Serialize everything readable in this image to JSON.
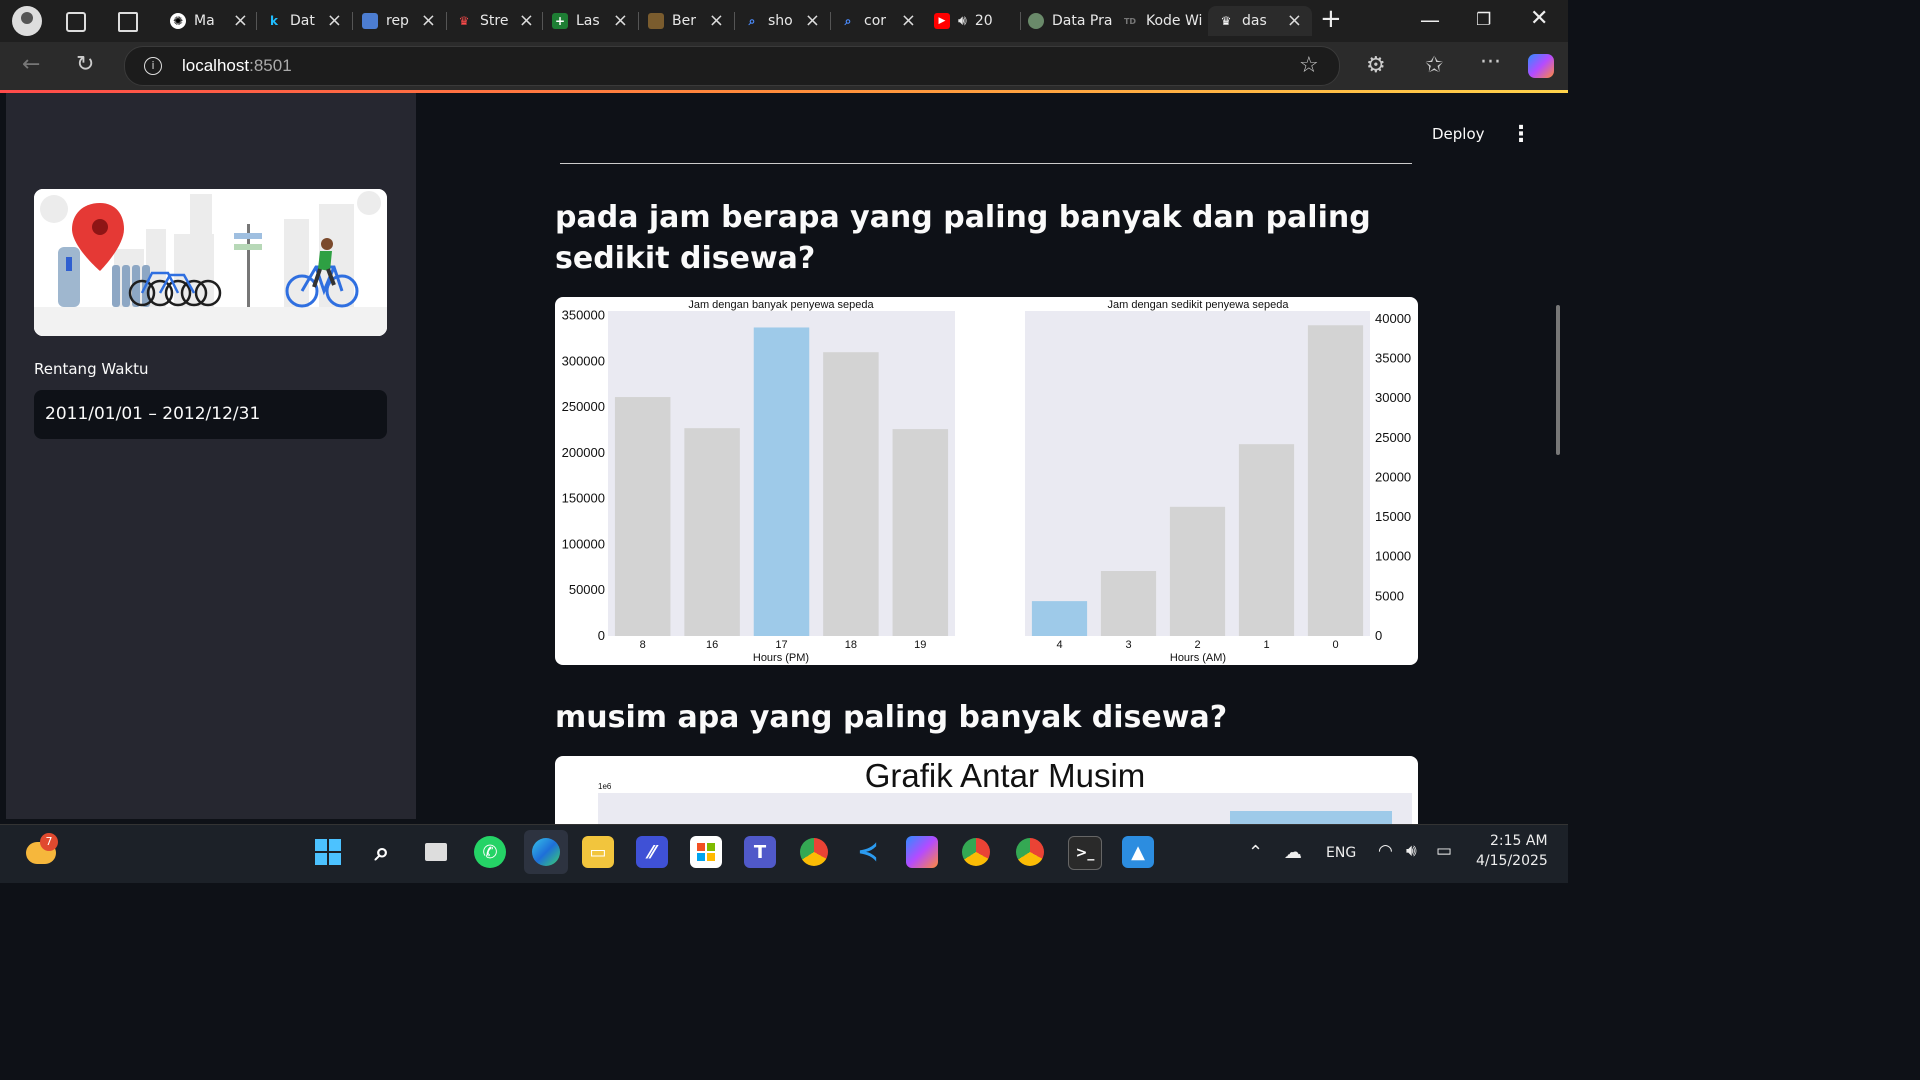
{
  "browser": {
    "tabs": [
      {
        "label": "Ma"
      },
      {
        "label": "Dat"
      },
      {
        "label": "rep"
      },
      {
        "label": "Stre"
      },
      {
        "label": "Las"
      },
      {
        "label": "Ber"
      },
      {
        "label": "sho"
      },
      {
        "label": "cor"
      },
      {
        "label": "20"
      },
      {
        "label": "Data Pra"
      },
      {
        "label": "Kode Wi"
      },
      {
        "label": "das"
      }
    ],
    "url_host": "localhost",
    "url_port": ":8501"
  },
  "sidebar": {
    "date_label": "Rentang Waktu",
    "date_value": "2011/01/01 – 2012/12/31"
  },
  "header": {
    "deploy_label": "Deploy"
  },
  "main": {
    "question1": "pada jam berapa yang paling banyak dan paling sedikit disewa?",
    "question2": "musim apa yang paling banyak disewa?"
  },
  "chart_data": [
    {
      "type": "bar",
      "title": "Jam dengan banyak penyewa sepeda",
      "xlabel": "Hours (PM)",
      "ylabel": "",
      "categories": [
        "8",
        "16",
        "17",
        "18",
        "19"
      ],
      "values": [
        261000,
        227000,
        337000,
        310000,
        226000
      ],
      "highlight_index": 2,
      "ylim": [
        0,
        355000
      ],
      "yticks": [
        0,
        50000,
        100000,
        150000,
        200000,
        250000,
        300000,
        350000
      ],
      "yaxis_side": "left"
    },
    {
      "type": "bar",
      "title": "Jam dengan sedikit penyewa sepeda",
      "xlabel": "Hours (AM)",
      "ylabel": "",
      "categories": [
        "4",
        "3",
        "2",
        "1",
        "0"
      ],
      "values": [
        4400,
        8200,
        16300,
        24200,
        39200
      ],
      "highlight_index": 0,
      "ylim": [
        0,
        41000
      ],
      "yticks": [
        0,
        5000,
        10000,
        15000,
        20000,
        25000,
        30000,
        35000,
        40000
      ],
      "yaxis_side": "right"
    },
    {
      "type": "bar",
      "title": "Grafik Antar Musim",
      "y_offset_label": "1e6"
    }
  ],
  "taskbar": {
    "weather_badge": "7",
    "lang": "ENG",
    "time": "2:15 AM",
    "date": "4/15/2025"
  },
  "colors": {
    "highlight_bar": "#9ecae9",
    "base_bar": "#d3d3d3",
    "plot_bg": "#eaeaf2",
    "accent": "#ff4b4b"
  }
}
